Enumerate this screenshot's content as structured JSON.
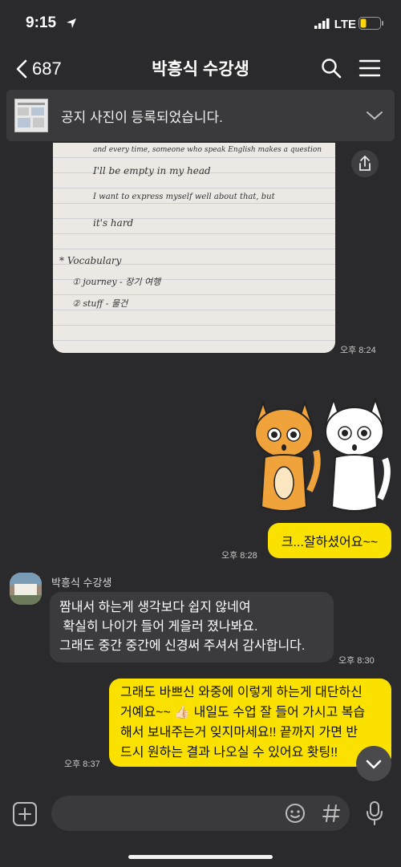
{
  "status_bar": {
    "time": "9:15",
    "network": "LTE"
  },
  "header": {
    "back_count": "687",
    "title": "박흥식 수강생"
  },
  "notice": {
    "text": "공지 사진이 등록되었습니다."
  },
  "photo_message": {
    "time": "오후 8:24",
    "handwriting": [
      "and every time, someone who speak English makes a question",
      "I'll be empty in my head",
      "I want to express myself well about that, but",
      "it's hard",
      "* Vocabulary",
      "① journey - 장기 여행",
      "② stuff - 물건"
    ]
  },
  "sticker_message": {
    "time": ""
  },
  "messages": [
    {
      "from": "me",
      "text": "크...잘하셨어요~~",
      "time": "오후 8:28"
    },
    {
      "from": "them",
      "sender": "박흥식 수강생",
      "lines": [
        "짬내서 하는게 생각보다 쉽지 않네여",
        " 확실히 나이가 들어 게을러 졌나봐요.",
        "그래도 중간 중간에 신경써 주셔서 감사합니다."
      ],
      "time": "오후 8:30"
    },
    {
      "from": "me",
      "lines": [
        "그래도 바쁘신 와중에 이렇게 하는게 대단하신",
        "거예요~~ 👍🏻 내일도 수업 잘 들어 가시고 복습",
        "해서 보내주는거 잊지마세요!! 끝까지 가면 반",
        "드시 원하는 결과 나오실 수 있어요 홧팅!!"
      ],
      "time": "오후 8:37"
    }
  ],
  "input_bar": {
    "placeholder": ""
  }
}
